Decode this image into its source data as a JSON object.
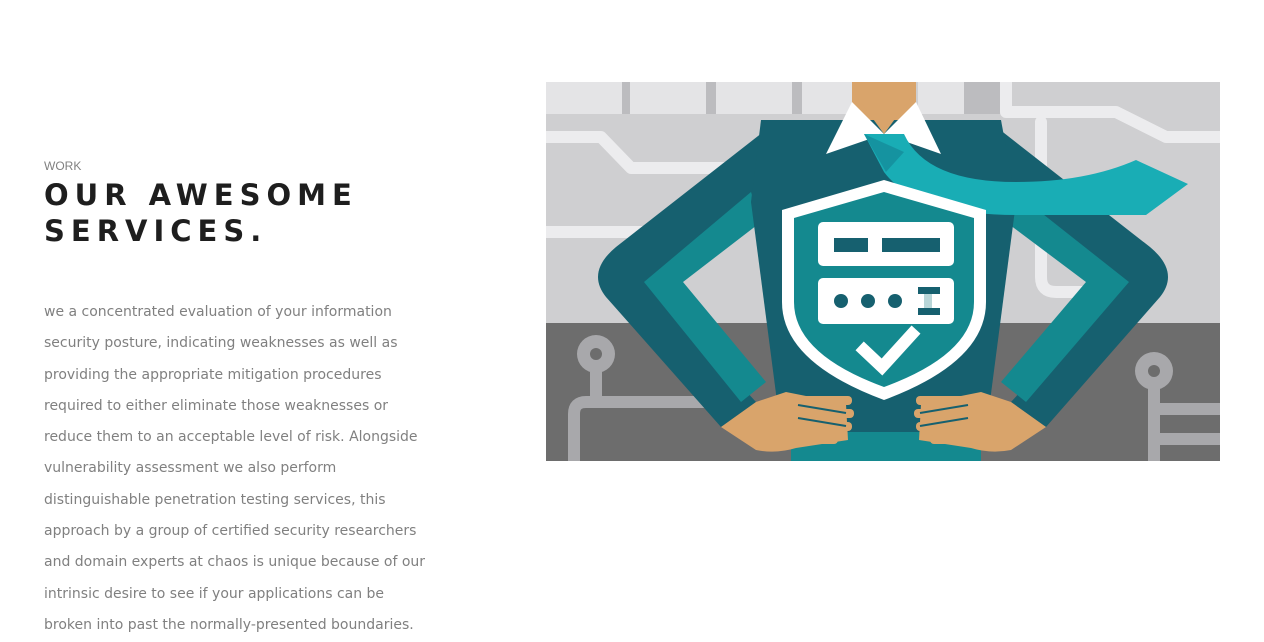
{
  "section": {
    "eyebrow": "WORK",
    "title_line1": "OUR AWESOME",
    "title_line2": "SERVICES.",
    "description": "we a concentrated evaluation of your information security posture, indicating weaknesses as well as providing the appropriate mitigation procedures required to either eliminate those weaknesses or reduce them to an acceptable level of risk. Alongside vulnerability assessment we also perform distinguishable penetration testing services, this approach by a group of certified security researchers and domain experts at chaos is unique because of our intrinsic desire to see if your applications can be broken into past the normally-presented boundaries."
  },
  "illustration": {
    "subject": "superhero-security-shield-illustration",
    "colors": {
      "bg_light": "#cfcfd1",
      "bg_dark": "#6d6d6d",
      "suit": "#16606f",
      "suit_accent": "#14898f",
      "tie": "#19adb5",
      "skin": "#d9a46b",
      "shield_inner": "#14898f"
    }
  }
}
